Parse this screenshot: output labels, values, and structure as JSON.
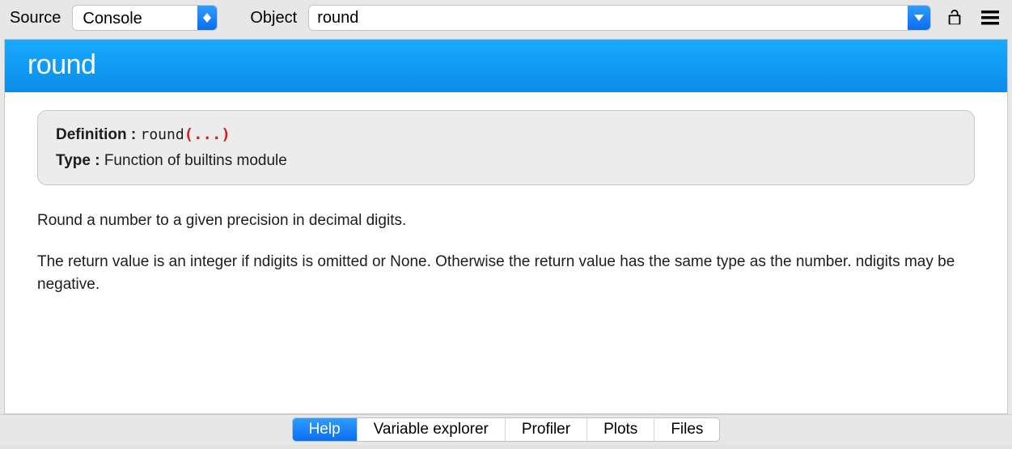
{
  "toolbar": {
    "source_label": "Source",
    "source_value": "Console",
    "object_label": "Object",
    "object_value": "round"
  },
  "title": "round",
  "definition": {
    "label": "Definition :",
    "func_name": "round",
    "args": "(...)",
    "type_label": "Type :",
    "type_value": "Function of builtins module"
  },
  "description": {
    "p1": "Round a number to a given precision in decimal digits.",
    "p2": "The return value is an integer if ndigits is omitted or None. Otherwise the return value has the same type as the number. ndigits may be negative."
  },
  "tabs": {
    "help": "Help",
    "variable_explorer": "Variable explorer",
    "profiler": "Profiler",
    "plots": "Plots",
    "files": "Files"
  }
}
